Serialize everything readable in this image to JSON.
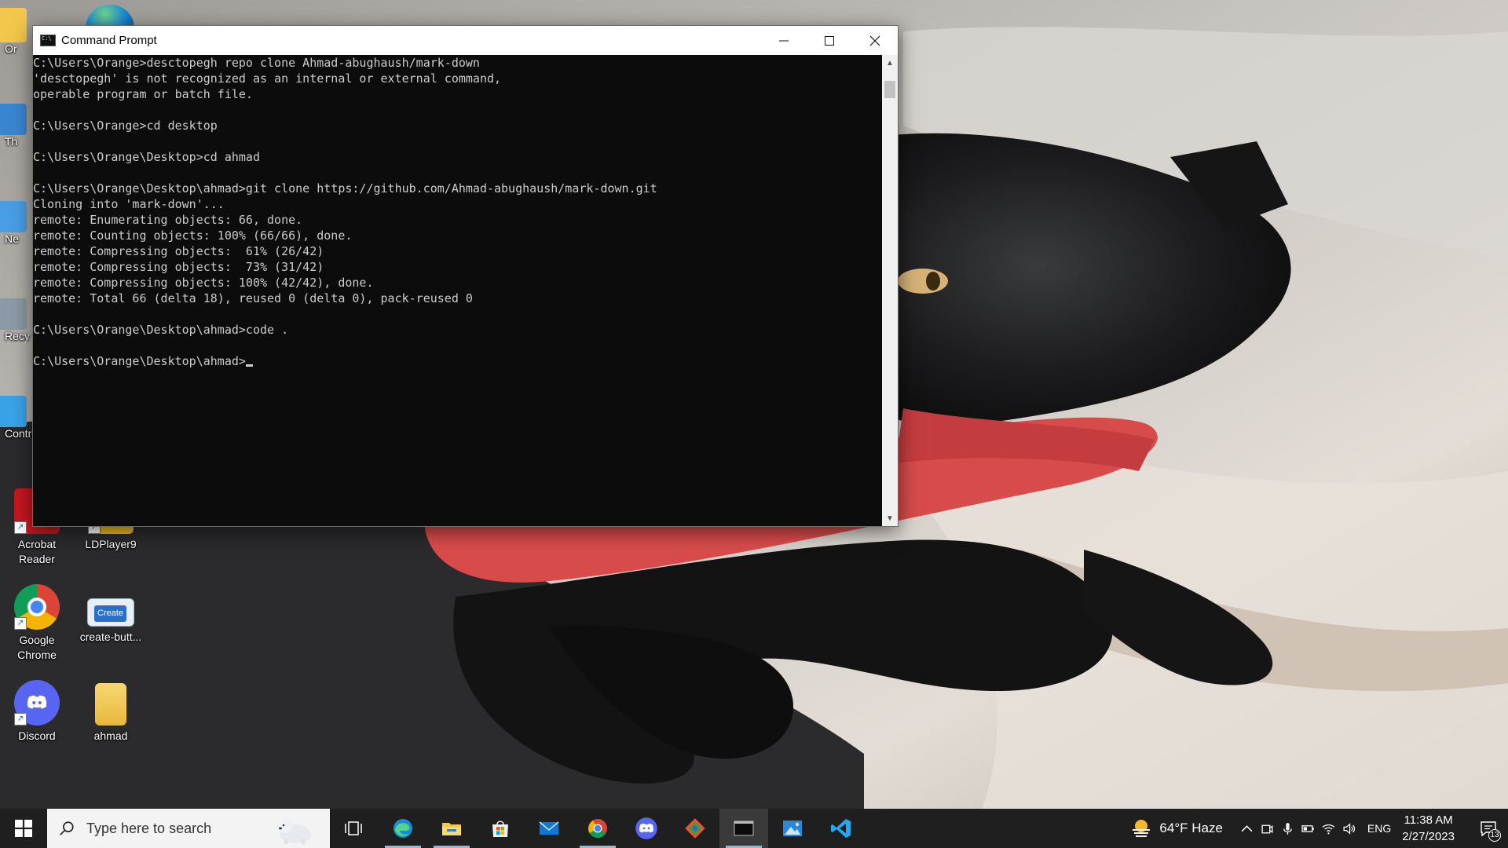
{
  "window": {
    "title": "Command Prompt",
    "console_lines": [
      "C:\\Users\\Orange>desctopegh repo clone Ahmad-abughaush/mark-down",
      "'desctopegh' is not recognized as an internal or external command,",
      "operable program or batch file.",
      "",
      "C:\\Users\\Orange>cd desktop",
      "",
      "C:\\Users\\Orange\\Desktop>cd ahmad",
      "",
      "C:\\Users\\Orange\\Desktop\\ahmad>git clone https://github.com/Ahmad-abughaush/mark-down.git",
      "Cloning into 'mark-down'...",
      "remote: Enumerating objects: 66, done.",
      "remote: Counting objects: 100% (66/66), done.",
      "remote: Compressing objects:  61% (26/42)",
      "remote: Compressing objects:  73% (31/42)",
      "remote: Compressing objects: 100% (42/42), done.",
      "remote: Total 66 (delta 18), reused 0 (delta 0), pack-reused 0",
      "",
      "C:\\Users\\Orange\\Desktop\\ahmad>code .",
      "",
      "C:\\Users\\Orange\\Desktop\\ahmad>"
    ]
  },
  "desktop": {
    "partial_labels": [
      "Or",
      "Th",
      "Ne",
      "Recy",
      "Contr"
    ],
    "icons": [
      {
        "label": "Acrobat Reader",
        "icon": "acrobat-icon"
      },
      {
        "label": "LDPlayer9",
        "icon": "ldplayer-icon"
      },
      {
        "label": "Google Chrome",
        "icon": "chrome-icon"
      },
      {
        "label": "create-butt...",
        "icon": "create-button-file-icon",
        "badge": "Create"
      },
      {
        "label": "Discord",
        "icon": "discord-icon"
      },
      {
        "label": "ahmad",
        "icon": "folder-icon"
      }
    ]
  },
  "taskbar": {
    "search_placeholder": "Type here to search",
    "apps": [
      "task-view-icon",
      "edge-icon",
      "file-explorer-icon",
      "microsoft-store-icon",
      "mail-icon",
      "chrome-icon",
      "discord-icon",
      "git-icon",
      "command-prompt-icon",
      "photos-icon",
      "vscode-icon"
    ],
    "weather": "64°F  Haze",
    "language": "ENG",
    "time": "11:38 AM",
    "date": "2/27/2023",
    "notification_count": "13"
  },
  "colors": {
    "console_bg": "#0c0c0c",
    "console_text": "#cccccc",
    "taskbar_bg": "#1f1f1f",
    "accent": "#0078d7"
  }
}
